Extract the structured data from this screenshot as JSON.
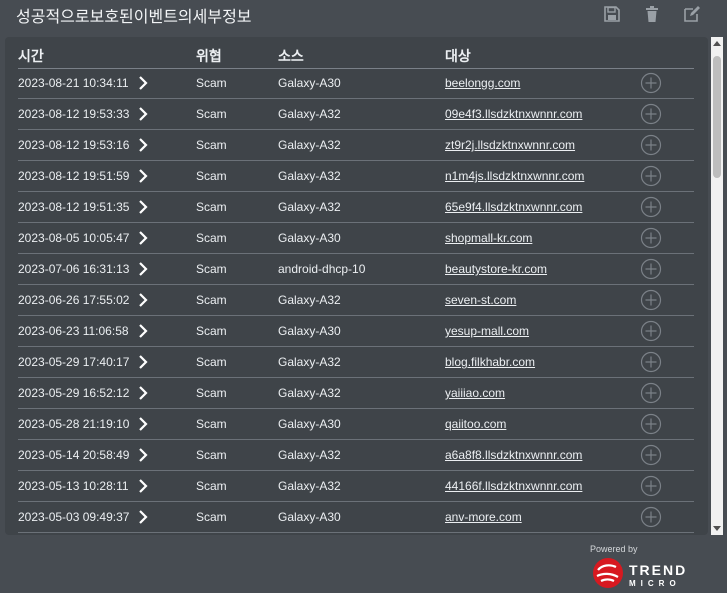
{
  "page": {
    "title": "성공적으로보호된이벤트의세부정보"
  },
  "toolbar": {
    "icons": [
      "save-icon",
      "trash-icon",
      "edit-icon"
    ]
  },
  "table": {
    "columns": {
      "time": "시간",
      "threat": "위협",
      "source": "소스",
      "target": "대상"
    },
    "rows": [
      {
        "time": "2023-08-21 10:34:11",
        "threat": "Scam",
        "source": "Galaxy-A30",
        "target": "beelongg.com"
      },
      {
        "time": "2023-08-12 19:53:33",
        "threat": "Scam",
        "source": "Galaxy-A32",
        "target": "09e4f3.llsdzktnxwnnr.com"
      },
      {
        "time": "2023-08-12 19:53:16",
        "threat": "Scam",
        "source": "Galaxy-A32",
        "target": "zt9r2j.llsdzktnxwnnr.com"
      },
      {
        "time": "2023-08-12 19:51:59",
        "threat": "Scam",
        "source": "Galaxy-A32",
        "target": "n1m4js.llsdzktnxwnnr.com"
      },
      {
        "time": "2023-08-12 19:51:35",
        "threat": "Scam",
        "source": "Galaxy-A32",
        "target": "65e9f4.llsdzktnxwnnr.com"
      },
      {
        "time": "2023-08-05 10:05:47",
        "threat": "Scam",
        "source": "Galaxy-A30",
        "target": "shopmall-kr.com"
      },
      {
        "time": "2023-07-06 16:31:13",
        "threat": "Scam",
        "source": "android-dhcp-10",
        "target": "beautystore-kr.com"
      },
      {
        "time": "2023-06-26 17:55:02",
        "threat": "Scam",
        "source": "Galaxy-A32",
        "target": "seven-st.com"
      },
      {
        "time": "2023-06-23 11:06:58",
        "threat": "Scam",
        "source": "Galaxy-A30",
        "target": "yesup-mall.com"
      },
      {
        "time": "2023-05-29 17:40:17",
        "threat": "Scam",
        "source": "Galaxy-A32",
        "target": "blog.filkhabr.com"
      },
      {
        "time": "2023-05-29 16:52:12",
        "threat": "Scam",
        "source": "Galaxy-A32",
        "target": "yaiiiao.com"
      },
      {
        "time": "2023-05-28 21:19:10",
        "threat": "Scam",
        "source": "Galaxy-A30",
        "target": "qaiitoo.com"
      },
      {
        "time": "2023-05-14 20:58:49",
        "threat": "Scam",
        "source": "Galaxy-A32",
        "target": "a6a8f8.llsdzktnxwnnr.com"
      },
      {
        "time": "2023-05-13 10:28:11",
        "threat": "Scam",
        "source": "Galaxy-A32",
        "target": "44166f.llsdzktnxwnnr.com"
      },
      {
        "time": "2023-05-03 09:49:37",
        "threat": "Scam",
        "source": "Galaxy-A30",
        "target": "anv-more.com"
      }
    ]
  },
  "footer": {
    "powered_by": "Powered by",
    "logo_line1": "TREND",
    "logo_line2": "MICRO"
  },
  "colors": {
    "background": "#474c52",
    "panel": "#3f4449",
    "brand_red": "#d71920"
  }
}
